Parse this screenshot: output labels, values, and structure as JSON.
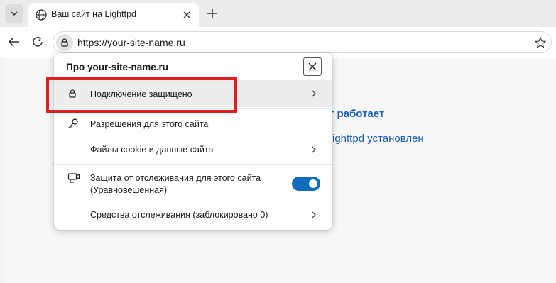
{
  "tab": {
    "title": "Ваш сайт на Lighttpd",
    "favicon": "globe-icon"
  },
  "toolbar": {
    "url": "https://your-site-name.ru"
  },
  "page": {
    "heading": "т работает",
    "line": "ighttpd установлен"
  },
  "flyout": {
    "title": "Про your-site-name.ru",
    "items": [
      {
        "label": "Подключение защищено",
        "icon": "lock-icon",
        "chevron": true
      },
      {
        "label": "Разрешения для этого сайта",
        "icon": "key-icon",
        "chevron": false
      },
      {
        "label": "Файлы cookie и данные сайта",
        "icon": "",
        "chevron": true
      },
      {
        "label": "Защита от отслеживания для этого сайта",
        "label2": "(Уравновешенная)",
        "icon": "tracking-camera-icon",
        "toggle_on": true
      },
      {
        "label": "Средства отслеживания (заблокировано 0)",
        "icon": "",
        "chevron": true
      }
    ]
  },
  "colors": {
    "accent": "#0f6cbd",
    "highlight": "#e02020",
    "link": "#1a5fb4"
  }
}
